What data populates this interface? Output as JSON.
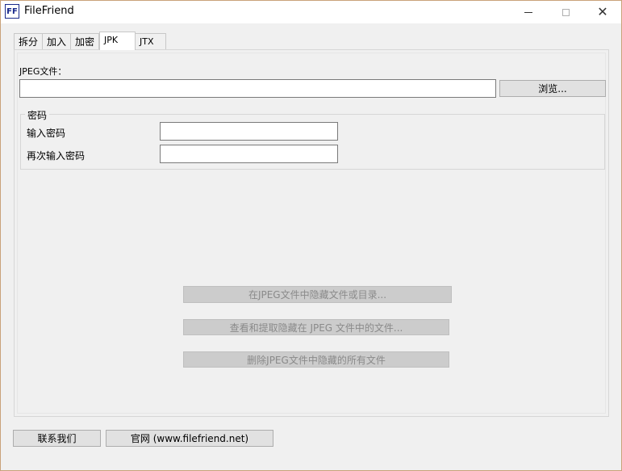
{
  "window": {
    "icon_text": "FF",
    "title": "FileFriend",
    "close_glyph": "✕"
  },
  "tabs": [
    {
      "label": "拆分"
    },
    {
      "label": "加入"
    },
    {
      "label": "加密"
    },
    {
      "label": "JPK",
      "active": true
    },
    {
      "label": "JTX"
    }
  ],
  "jpeg": {
    "label": "JPEG文件：",
    "path_value": "",
    "browse_label": "浏览..."
  },
  "password": {
    "group_title": "密码",
    "enter_label": "输入密码",
    "enter_value": "",
    "confirm_label": "再次输入密码",
    "confirm_value": ""
  },
  "actions": {
    "hide_label": "在JPEG文件中隐藏文件或目录...",
    "extract_label": "查看和提取隐藏在 JPEG 文件中的文件...",
    "delete_label": "删除JPEG文件中隐藏的所有文件"
  },
  "footer": {
    "contact_label": "联系我们",
    "website_label": "官网 (www.filefriend.net)"
  },
  "colors": {
    "window_bg": "#f0f0f0",
    "titlebar_bg": "#ffffff",
    "icon_blue": "#1a2a8c",
    "disabled_button": "#cccccc"
  }
}
